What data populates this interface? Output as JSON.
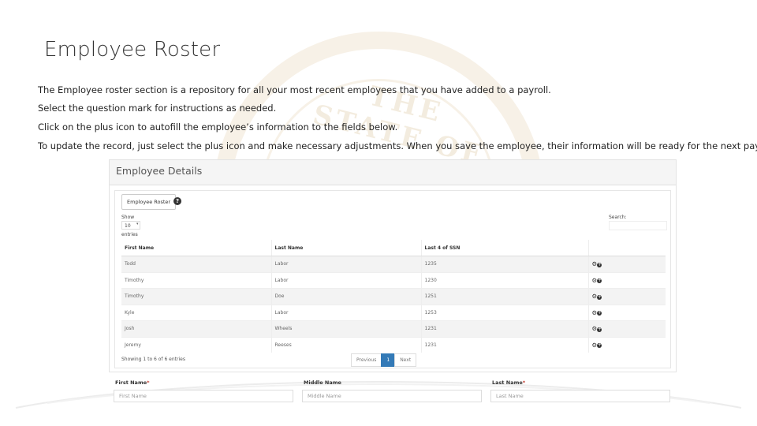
{
  "slide": {
    "title": "Employee Roster",
    "paragraphs": [
      "The Employee roster section is a repository for all your most recent employees that you have added to a payroll.",
      "Select the question mark for instructions as needed.",
      "Click on the plus icon to autofill the employee’s information to the fields below.",
      "To update the record, just select the plus icon and make necessary adjustments.  When you save the employee, their information will be ready for the next payroll."
    ],
    "watermark_text": "THE STATE OF"
  },
  "panel": {
    "title": "Employee Details",
    "roster_button": "Employee Roster",
    "help_icon": "question-circle-icon",
    "show_label": "Show",
    "show_value": "10",
    "entries_label": "entries",
    "search_label": "Search:",
    "table": {
      "columns": [
        "First Name",
        "Last Name",
        "Last 4 of SSN",
        ""
      ],
      "rows": [
        [
          "Todd",
          "Labor",
          "1235"
        ],
        [
          "Timothy",
          "Labor",
          "1230"
        ],
        [
          "Timothy",
          "Doe",
          "1251"
        ],
        [
          "Kyle",
          "Labor",
          "1253"
        ],
        [
          "Josh",
          "Wheels",
          "1231"
        ],
        [
          "Jeremy",
          "Reeses",
          "1231"
        ]
      ],
      "row_action_icons": [
        "gear-icon",
        "plus-circle-icon"
      ]
    },
    "showing_text": "Showing 1 to 6 of 6 entries",
    "pager": {
      "previous": "Previous",
      "current": "1",
      "next": "Next"
    }
  },
  "form": {
    "first_name_label": "First Name",
    "first_name_placeholder": "First Name",
    "middle_name_label": "Middle Name",
    "middle_name_placeholder": "Middle Name",
    "last_name_label": "Last Name",
    "last_name_placeholder": "Last Name",
    "required_mark": "*"
  },
  "colors": {
    "accent": "#337ab7",
    "required": "#c0392b",
    "watermark": "#d2b478"
  }
}
